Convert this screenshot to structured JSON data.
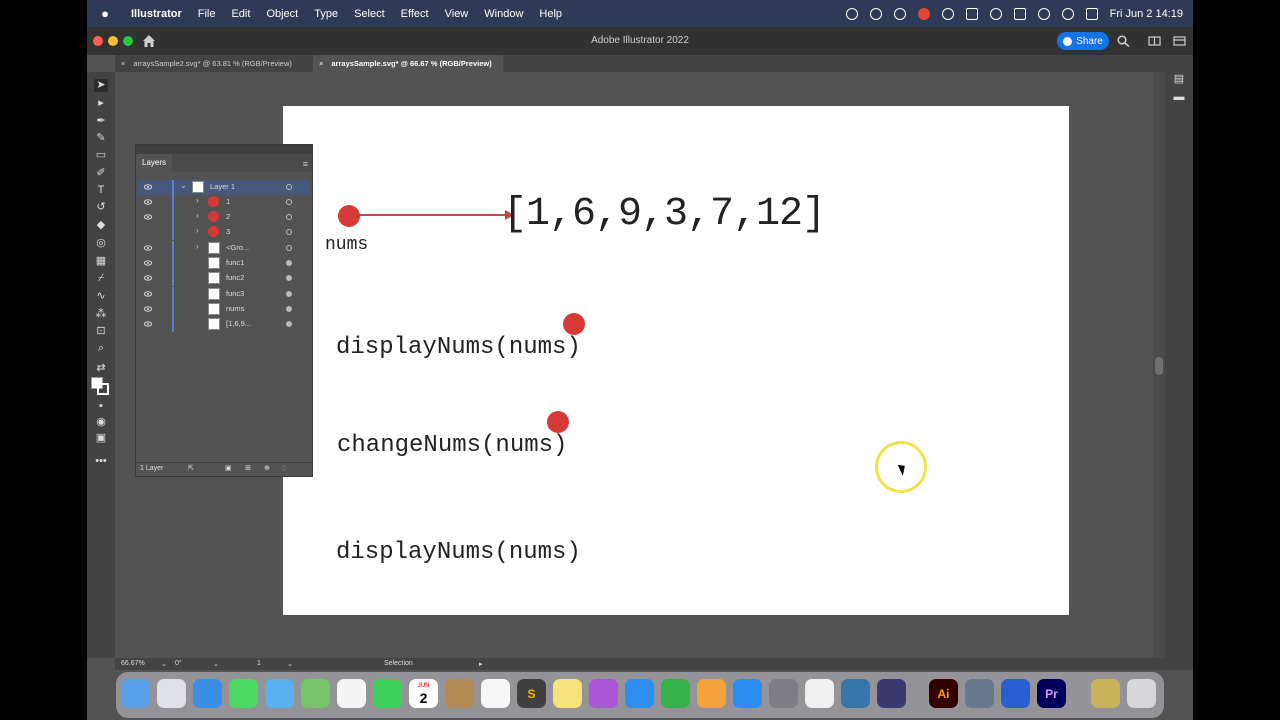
{
  "menubar": {
    "app_name": "Illustrator",
    "items": [
      "File",
      "Edit",
      "Object",
      "Type",
      "Select",
      "Effect",
      "View",
      "Window",
      "Help"
    ],
    "datetime": "Fri Jun 2  14:19"
  },
  "window": {
    "title": "Adobe Illustrator 2022",
    "share_label": "Share"
  },
  "tabs": [
    {
      "label": "arraysSample2.svg* @ 63.81 % (RGB/Preview)",
      "active": false
    },
    {
      "label": "arraysSample.svg* @ 66.67 % (RGB/Preview)",
      "active": true
    }
  ],
  "tab_close": "×",
  "artboard": {
    "array_text": "[1,6,9,3,7,12]",
    "nums_label": "nums",
    "line1": "displayNums(nums)",
    "line2": "changeNums(nums)",
    "line3": "displayNums(nums)"
  },
  "layers_panel": {
    "tab_label": "Layers",
    "rows": [
      {
        "name": "Layer 1",
        "kind": "layer"
      },
      {
        "name": "1",
        "kind": "red"
      },
      {
        "name": "2",
        "kind": "red"
      },
      {
        "name": "3",
        "kind": "red"
      },
      {
        "name": "<Gro...",
        "kind": "group"
      },
      {
        "name": "func1",
        "kind": "text"
      },
      {
        "name": "func2",
        "kind": "text"
      },
      {
        "name": "func3",
        "kind": "text"
      },
      {
        "name": "nums",
        "kind": "text"
      },
      {
        "name": "[1,6,9...",
        "kind": "text"
      }
    ],
    "footer_label": "1 Layer"
  },
  "statusbar": {
    "zoom": "66.67%",
    "rotation": "0°",
    "artboard_num": "1",
    "tool_name": "Selection"
  },
  "dock": {
    "calendar_month": "JUN",
    "calendar_day": "2",
    "ai_label": "Ai",
    "pr_label": "Pr"
  }
}
